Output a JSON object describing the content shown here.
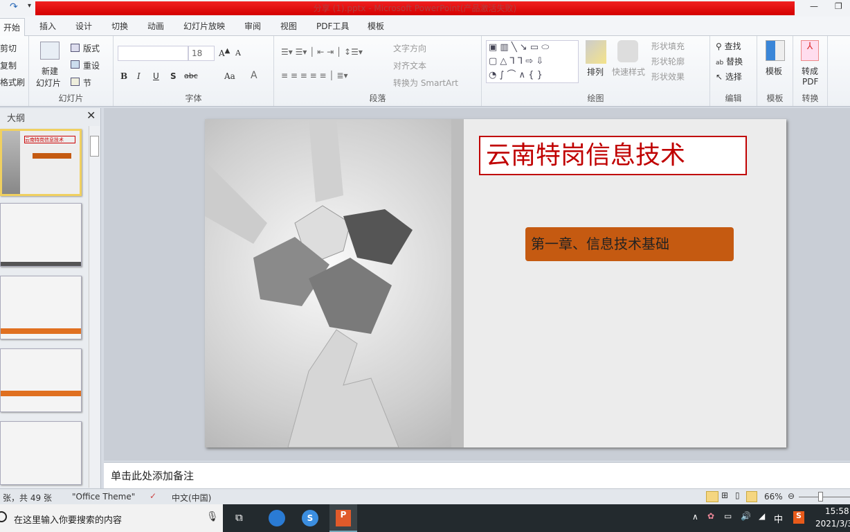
{
  "window": {
    "title": "分享 (1).pptx - Microsoft PowerPoint(产品激活失败)",
    "title_color": "#e00000"
  },
  "tabs": [
    "开始",
    "插入",
    "设计",
    "切换",
    "动画",
    "幻灯片放映",
    "审阅",
    "视图",
    "PDF工具",
    "模板"
  ],
  "ribbon": {
    "clipboard": {
      "cut": "剪切",
      "copy": "复制",
      "format_painter": "格式刷"
    },
    "slides": {
      "new_slide": "新建",
      "new_slide2": "幻灯片",
      "layout": "版式",
      "reset": "重设",
      "section": "节",
      "label": "幻灯片"
    },
    "font": {
      "size": "18",
      "label": "字体"
    },
    "paragraph": {
      "text_direction": "文字方向",
      "align_text": "对齐文本",
      "smartart": "转换为 SmartArt",
      "label": "段落"
    },
    "drawing": {
      "arrange": "排列",
      "quick_styles": "快速样式",
      "shape_fill": "形状填充",
      "shape_outline": "形状轮廓",
      "shape_effects": "形状效果",
      "label": "绘图"
    },
    "editing": {
      "find": "查找",
      "replace": "替换",
      "select": "选择",
      "label": "编辑"
    },
    "template": {
      "button": "模板",
      "label": "模板"
    },
    "convert": {
      "button1": "转成",
      "button2": "PDF",
      "label": "转换"
    }
  },
  "panel": {
    "tab": "大纲"
  },
  "slide": {
    "title": "云南特岗信息技术",
    "subtitle": "第一章、信息技术基础",
    "accent": "#c55a11",
    "title_color": "#c00000"
  },
  "notes": {
    "placeholder": "单击此处添加备注"
  },
  "status": {
    "slide_count": "张，共 49 张",
    "theme": "\"Office Theme\"",
    "language": "中文(中国)",
    "zoom": "66%",
    "zoom_level": 0.66
  },
  "taskbar": {
    "search_placeholder": "在这里输入你要搜索的内容",
    "time": "15:58",
    "date": "2021/3/3",
    "ime": "中"
  }
}
